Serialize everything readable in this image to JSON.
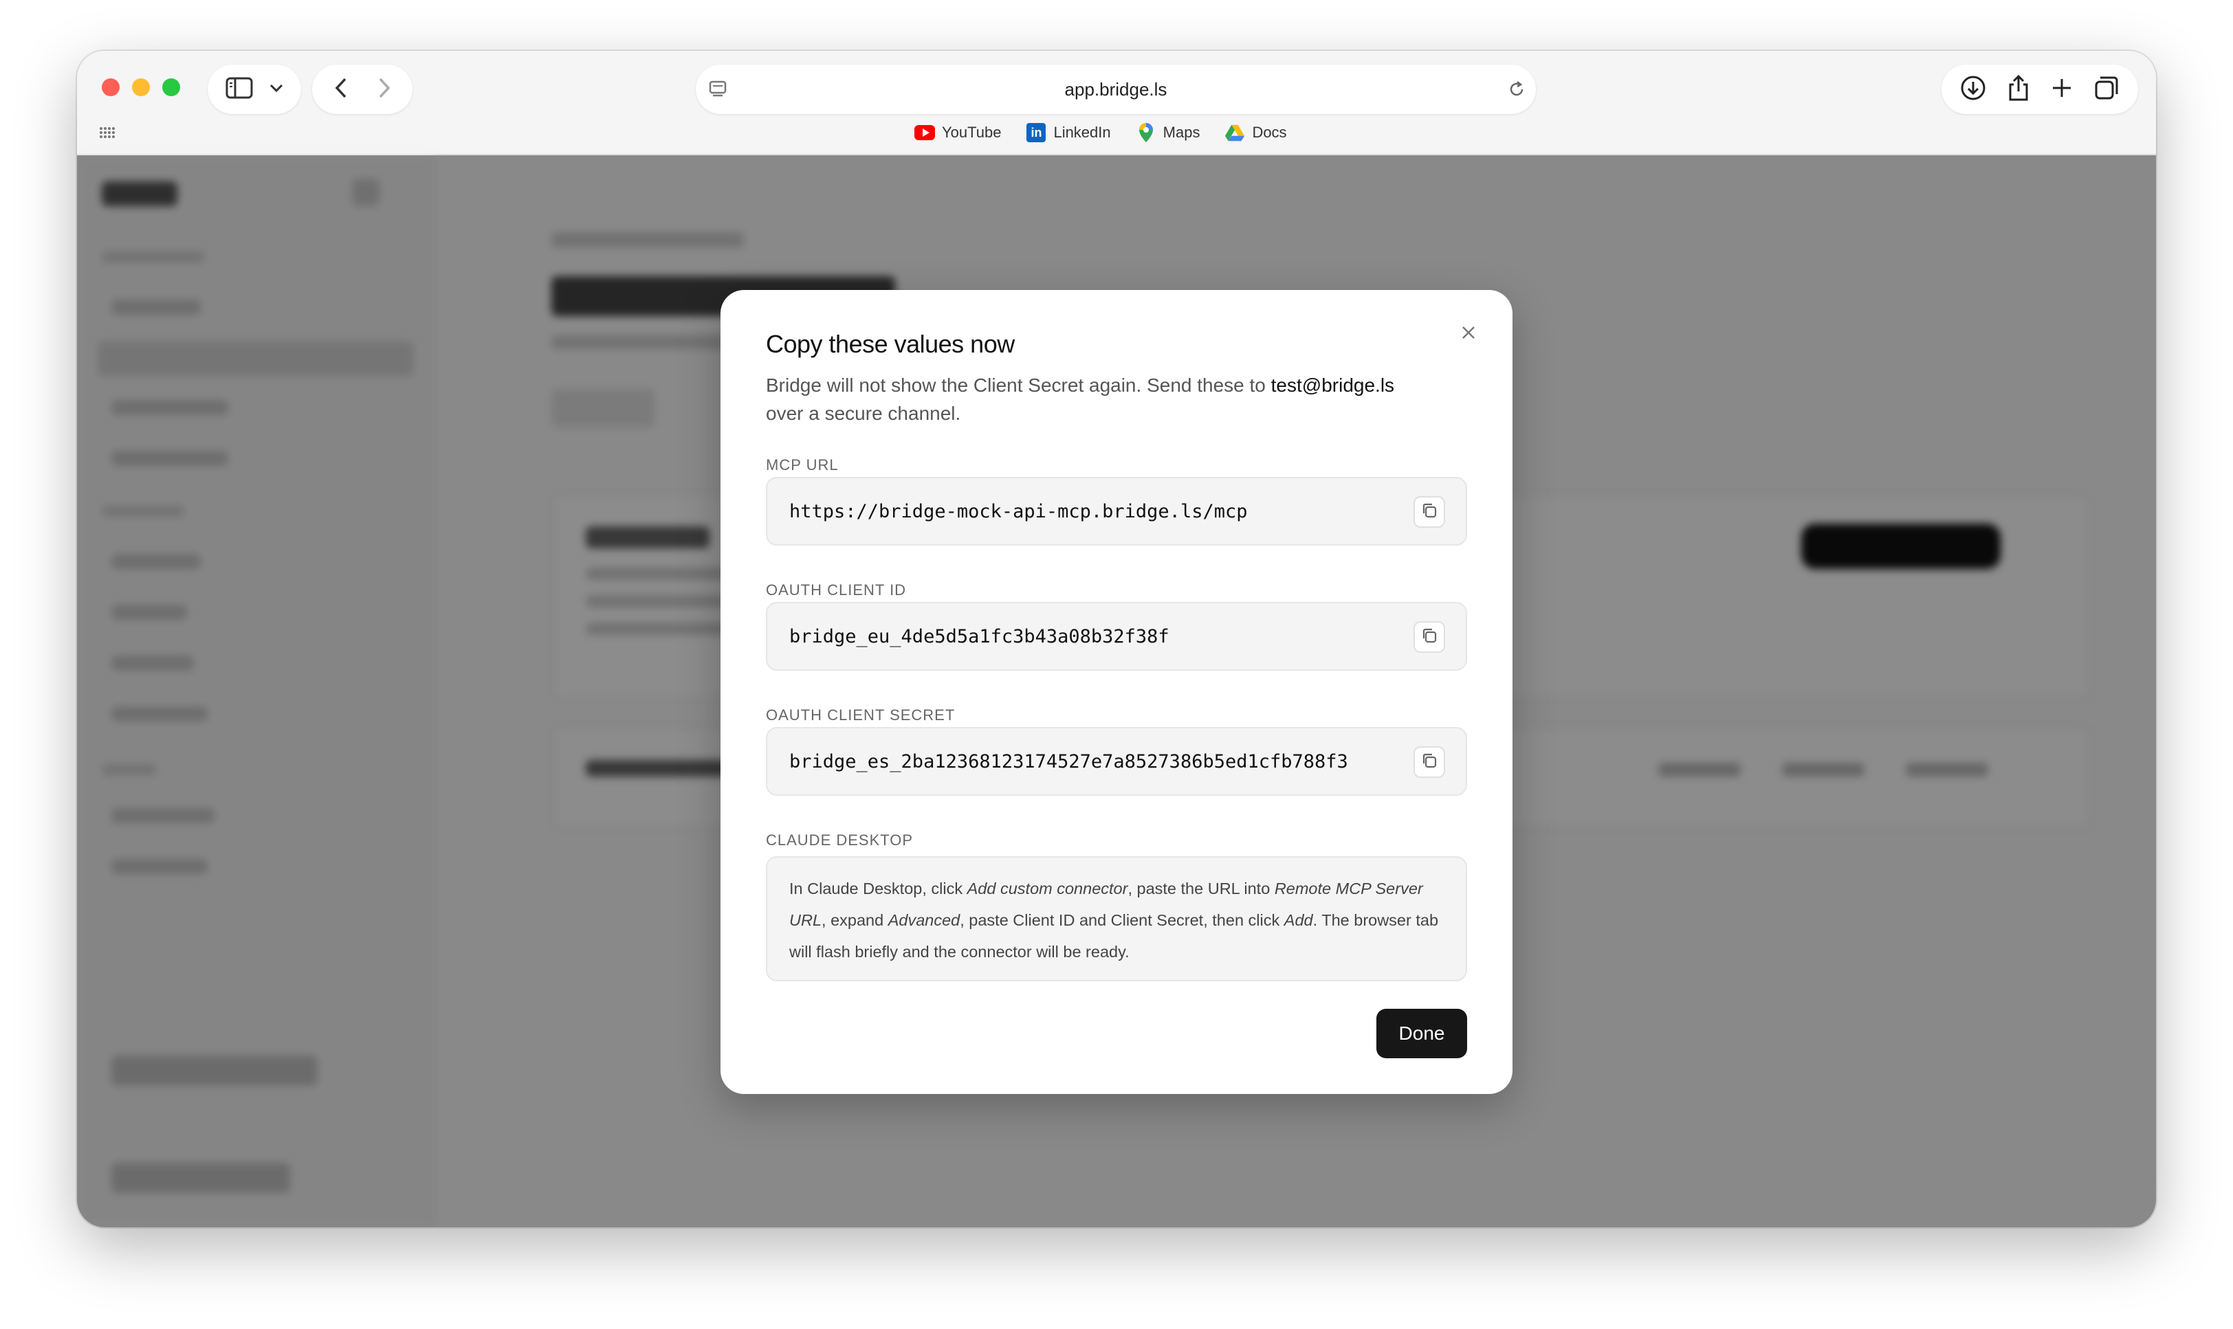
{
  "browser": {
    "url": "app.bridge.ls",
    "bookmarks": [
      {
        "label": "YouTube",
        "icon": "youtube-icon"
      },
      {
        "label": "LinkedIn",
        "icon": "linkedin-icon"
      },
      {
        "label": "Maps",
        "icon": "maps-icon"
      },
      {
        "label": "Docs",
        "icon": "drive-icon"
      }
    ]
  },
  "modal": {
    "title": "Copy these values now",
    "desc_before": "Bridge will not show the Client Secret again. Send these to ",
    "desc_email": "test@bridge.ls",
    "desc_after": " over a secure channel.",
    "fields": [
      {
        "label": "MCP URL",
        "value": "https://bridge-mock-api-mcp.bridge.ls/mcp"
      },
      {
        "label": "OAUTH CLIENT ID",
        "value": "bridge_eu_4de5d5a1fc3b43a08b32f38f"
      },
      {
        "label": "OAUTH CLIENT SECRET",
        "value": "bridge_es_2ba12368123174527e7a8527386b5ed1cfb788f3"
      }
    ],
    "claude": {
      "label": "CLAUDE DESKTOP",
      "t1": "In Claude Desktop, click ",
      "e1": "Add custom connector",
      "t2": ", paste the URL into ",
      "e2": "Remote MCP Server URL",
      "t3": ", expand ",
      "e3": "Advanced",
      "t4": ", paste Client ID and Client Secret, then click ",
      "e4": "Add",
      "t5": ". The browser tab will flash briefly and the connector will be ready."
    },
    "done_label": "Done"
  },
  "colors": {
    "primary_button": "#171717",
    "overlay": "rgba(0,0,0,0.45)"
  }
}
